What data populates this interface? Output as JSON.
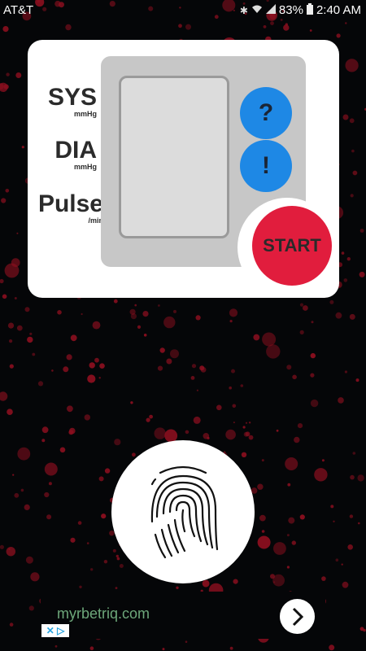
{
  "status_bar": {
    "carrier": "AT&T",
    "battery": "83%",
    "time": "2:40 AM",
    "icons": [
      "bluetooth-icon",
      "wifi-icon",
      "signal-icon",
      "battery-icon"
    ]
  },
  "monitor": {
    "sys_label": "SYS",
    "sys_unit": "mmHg",
    "dia_label": "DIA",
    "dia_unit": "mmHg",
    "pulse_label": "Pulse",
    "pulse_unit": "/min",
    "help_label": "?",
    "info_label": "!",
    "start_label": "START"
  },
  "fingerprint": {
    "icon": "fingerprint-icon"
  },
  "ad": {
    "url": "myrbetriq.com",
    "arrow_icon": "chevron-right-icon",
    "choices_icon": "adchoices-icon",
    "choices_text": "✕ ▷"
  },
  "colors": {
    "background": "#050608",
    "dots": "#8b0f1f",
    "blue_button": "#1e88e5",
    "start_button": "#e11d3d",
    "panel": "#c7c7c7"
  }
}
